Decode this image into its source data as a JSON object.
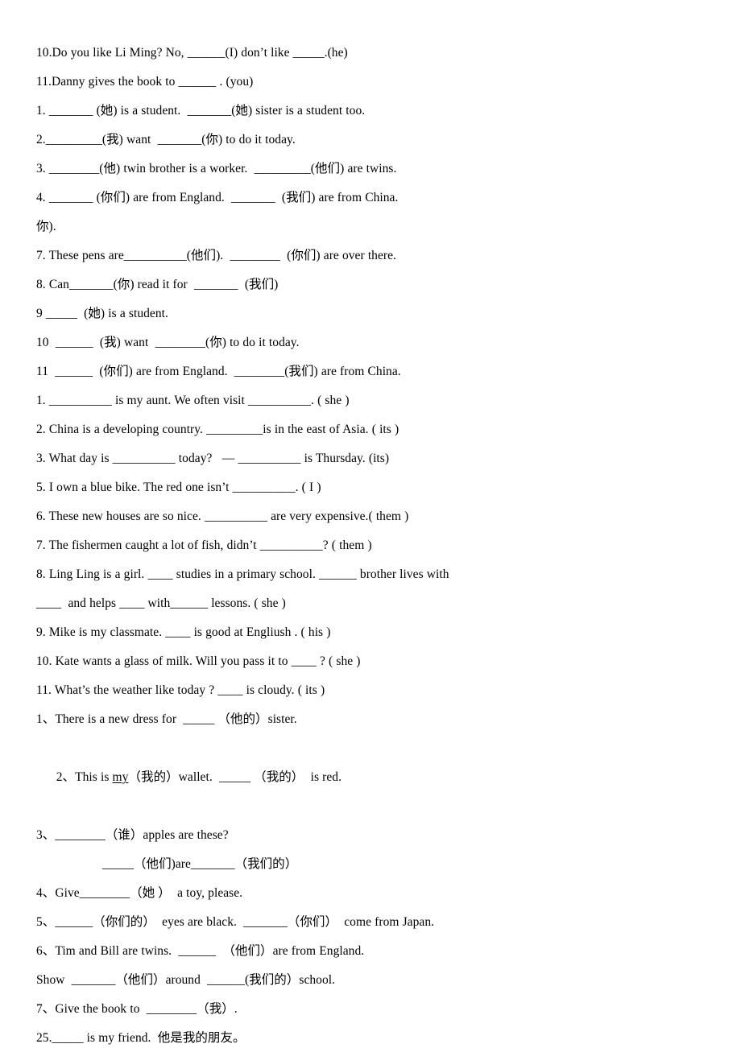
{
  "document": {
    "type": "worksheet",
    "language": "zh-CN/en",
    "page_background": "#ffffff",
    "text_color": "#000000",
    "lines": [
      {
        "id": "l01",
        "text": "10.Do you like Li Ming? No, ______(I) don’t like _____.(he)"
      },
      {
        "id": "l02",
        "text": "11.Danny gives the book to ______ . (you)"
      },
      {
        "id": "l03",
        "text": "1. _______ (她) is a student.  _______(她) sister is a student too."
      },
      {
        "id": "l04",
        "text": "2._________(我) want  _______(你) to do it today."
      },
      {
        "id": "l05",
        "text": "3. ________(他) twin brother is a worker.  _________(他们) are twins."
      },
      {
        "id": "l06",
        "text": "4. _______ (你们) are from England.  _______  (我们) are from China."
      },
      {
        "id": "l07",
        "text": "你)."
      },
      {
        "id": "l08",
        "text": "7. These pens are__________(他们).  ________  (你们) are over there."
      },
      {
        "id": "l09",
        "text": "8. Can_______(你) read it for  _______  (我们)"
      },
      {
        "id": "l10",
        "text": "9 _____  (她) is a student."
      },
      {
        "id": "l11",
        "text": "10  ______  (我) want  ________(你) to do it today."
      },
      {
        "id": "l12",
        "text": "11  ______  (你们) are from England.  ________(我们) are from China."
      },
      {
        "id": "l13",
        "text": "1. __________ is my aunt. We often visit __________. ( she )"
      },
      {
        "id": "l14",
        "text": "2. China is a developing country. _________is in the east of Asia. ( its )"
      },
      {
        "id": "l15",
        "text": "3. What day is __________ today?   — __________ is Thursday. (its)"
      },
      {
        "id": "l16",
        "text": "5. I own a blue bike. The red one isn’t __________. ( I )"
      },
      {
        "id": "l17",
        "text": "6. These new houses are so nice. __________ are very expensive.( them )"
      },
      {
        "id": "l18",
        "text": "7. The fishermen caught a lot of fish, didn’t __________? ( them )"
      },
      {
        "id": "l19",
        "text": "8. Ling Ling is a girl. ____ studies in a primary school. ______ brother lives with"
      },
      {
        "id": "l20",
        "text": "____  and helps ____ with______ lessons. ( she )"
      },
      {
        "id": "l21",
        "text": "9. Mike is my classmate. ____ is good at Engliush . ( his )"
      },
      {
        "id": "l22",
        "text": "10. Kate wants a glass of milk. Will you pass it to ____ ? ( she )"
      },
      {
        "id": "l23",
        "text": "11. What’s the weather like today ? ____ is cloudy. ( its )"
      },
      {
        "id": "l24",
        "text": "1、There is a new dress for  _____ （他的）sister."
      },
      {
        "id": "l25",
        "pre": "2、This is ",
        "underlined": "my",
        "post": "（我的）wallet.  _____ （我的）  is red."
      },
      {
        "id": "l26",
        "text": "3、________（谁）apples are these?"
      },
      {
        "id": "l27",
        "text": "_____（他们)are_______（我们的）",
        "indent": true
      },
      {
        "id": "l28",
        "text": "4、Give________（她 ）  a toy, please."
      },
      {
        "id": "l29",
        "text": "5、______（你们的）  eyes are black.  _______（你们）  come from Japan."
      },
      {
        "id": "l30",
        "text": "6、Tim and Bill are twins.  ______  （他们）are from England."
      },
      {
        "id": "l31",
        "text": "Show  _______（他们）around  ______(我们的）school."
      },
      {
        "id": "l32",
        "text": "7、Give the book to  ________（我）."
      },
      {
        "id": "l33",
        "text": "25._____ is my friend.  他是我的朋友。"
      }
    ]
  }
}
